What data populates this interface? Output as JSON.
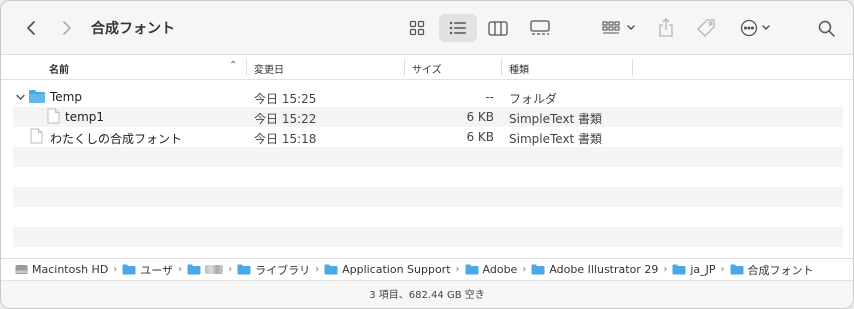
{
  "window": {
    "title": "合成フォント"
  },
  "toolbar": {
    "back_icon": "chevron-left-icon",
    "forward_icon": "chevron-right-icon",
    "view_modes": [
      "icons",
      "list",
      "columns",
      "gallery"
    ],
    "selected_view": "list"
  },
  "columns": {
    "name": "名前",
    "date": "変更日",
    "size": "サイズ",
    "kind": "種類",
    "sort_indicator": "^"
  },
  "rows": [
    {
      "name": "Temp",
      "date": "今日 15:25",
      "size": "--",
      "kind": "フォルダ",
      "type": "folder",
      "expanded": true,
      "indent": 0
    },
    {
      "name": "temp1",
      "date": "今日 15:22",
      "size": "6 KB",
      "kind": "SimpleText 書類",
      "type": "file",
      "indent": 1
    },
    {
      "name": "わたくしの合成フォント",
      "date": "今日 15:18",
      "size": "6 KB",
      "kind": "SimpleText 書類",
      "type": "file",
      "indent": 0
    }
  ],
  "pathbar": [
    {
      "label": "Macintosh HD",
      "icon": "hard-drive-icon"
    },
    {
      "label": "ユーザ",
      "icon": "folder-icon"
    },
    {
      "label": "",
      "icon": "folder-icon",
      "obscured": true
    },
    {
      "label": "ライブラリ",
      "icon": "folder-icon"
    },
    {
      "label": "Application Support",
      "icon": "folder-icon"
    },
    {
      "label": "Adobe",
      "icon": "folder-icon"
    },
    {
      "label": "Adobe Illustrator 29",
      "icon": "folder-icon"
    },
    {
      "label": "ja_JP",
      "icon": "folder-icon"
    },
    {
      "label": "合成フォント",
      "icon": "folder-icon"
    }
  ],
  "status": {
    "text": "3 項目、682.44 GB 空き"
  },
  "colors": {
    "folder": "#4aa8e8",
    "accent": "#1b7ce4"
  }
}
